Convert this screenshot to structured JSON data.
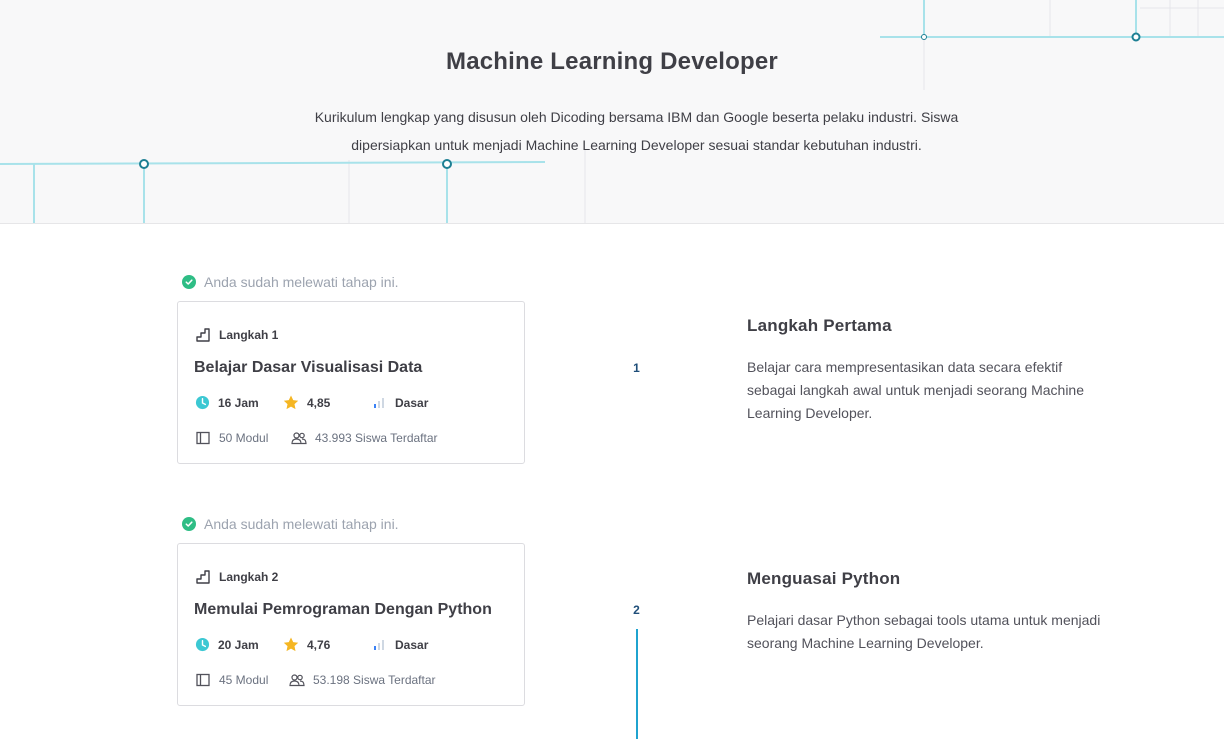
{
  "hero": {
    "title": "Machine Learning Developer",
    "description": "Kurikulum lengkap yang disusun oleh Dicoding bersama IBM dan Google beserta pelaku industri. Siswa dipersiapkan untuk menjadi Machine Learning Developer sesuai standar kebutuhan industri."
  },
  "colors": {
    "accent_teal": "#1fb5c9",
    "line_light": "#a8e2ea",
    "check_green": "#2ebd85",
    "star_yellow": "#f5b623",
    "clock_teal": "#3cc8d3"
  },
  "steps": [
    {
      "status": "Anda sudah melewati tahap ini.",
      "step_label": "Langkah 1",
      "course_title": "Belajar Dasar Visualisasi Data",
      "hours": "16 Jam",
      "rating": "4,85",
      "level": "Dasar",
      "modules": "50 Modul",
      "students": "43.993 Siswa Terdaftar",
      "number": "1",
      "desc_title": "Langkah Pertama",
      "desc_text": "Belajar cara mempresentasikan data secara efektif sebagai langkah awal untuk menjadi seorang Machine Learning Developer."
    },
    {
      "status": "Anda sudah melewati tahap ini.",
      "step_label": "Langkah 2",
      "course_title": "Memulai Pemrograman Dengan Python",
      "hours": "20 Jam",
      "rating": "4,76",
      "level": "Dasar",
      "modules": "45 Modul",
      "students": "53.198 Siswa Terdaftar",
      "number": "2",
      "desc_title": "Menguasai Python",
      "desc_text": "Pelajari dasar Python sebagai tools utama untuk menjadi seorang Machine Learning Developer."
    }
  ]
}
